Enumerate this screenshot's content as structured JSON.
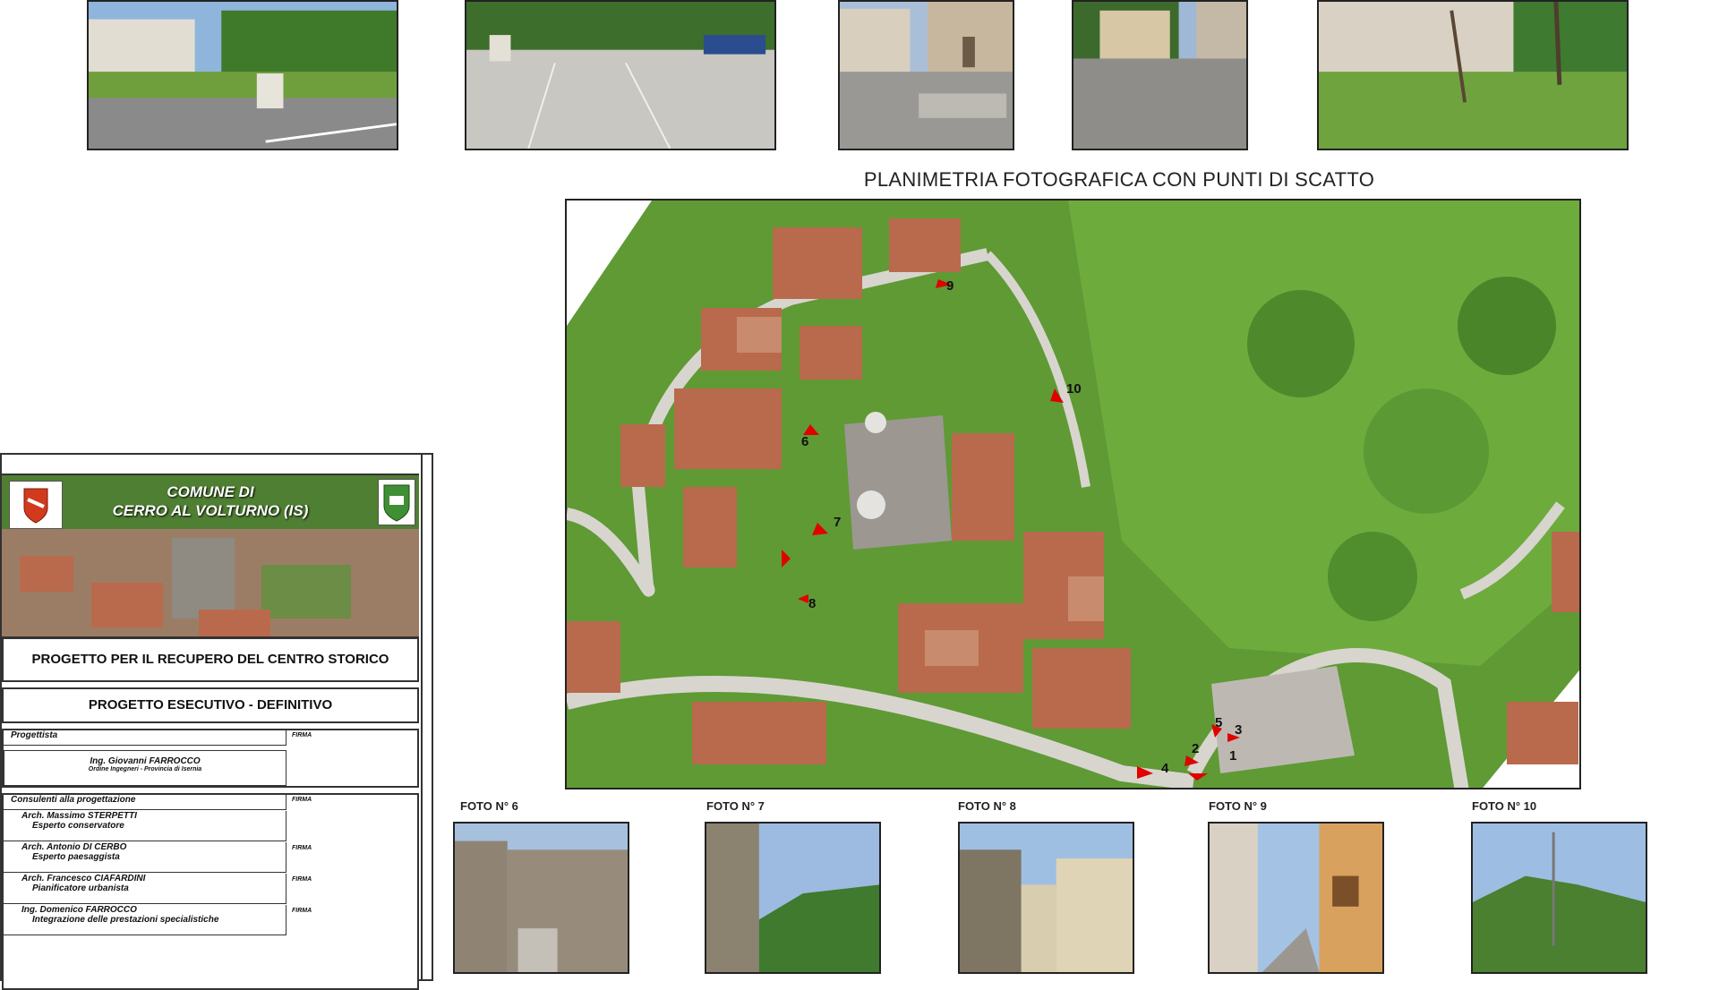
{
  "map": {
    "title": "PLANIMETRIA FOTOGRAFICA CON PUNTI DI SCATTO",
    "markers": [
      "1",
      "2",
      "3",
      "4",
      "5",
      "6",
      "7",
      "8",
      "9",
      "10"
    ]
  },
  "captions": [
    "FOTO N° 6",
    "FOTO N° 7",
    "FOTO N° 8",
    "FOTO N° 9",
    "FOTO N° 10"
  ],
  "title_block": {
    "comune_line1": "COMUNE DI",
    "comune_line2": "CERRO AL VOLTURNO (IS)",
    "project": "PROGETTO PER IL RECUPERO DEL CENTRO STORICO",
    "phase": "PROGETTO ESECUTIVO - DEFINITIVO",
    "designer_label": "Progettista",
    "designer_name": "Ing. Giovanni FARROCCO",
    "designer_sub": "Ordine Ingegneri - Provincia di Isernia",
    "firma": "FIRMA",
    "consultants_label": "Consulenti alla progettazione",
    "consultants": [
      {
        "name": "Arch. Massimo STERPETTI",
        "role": "Esperto conservatore"
      },
      {
        "name": "Arch. Antonio DI CERBO",
        "role": "Esperto paesaggista"
      },
      {
        "name": "Arch. Francesco CIAFARDINI",
        "role": "Pianificatore urbanista"
      },
      {
        "name": "Ing. Domenico FARROCCO",
        "role": "Integrazione delle prestazioni specialistiche"
      }
    ]
  },
  "colors": {
    "vegetation": "#5f9a35",
    "roof": "#b96a4c",
    "road": "#d9d6d0",
    "marker": "#e00000"
  }
}
